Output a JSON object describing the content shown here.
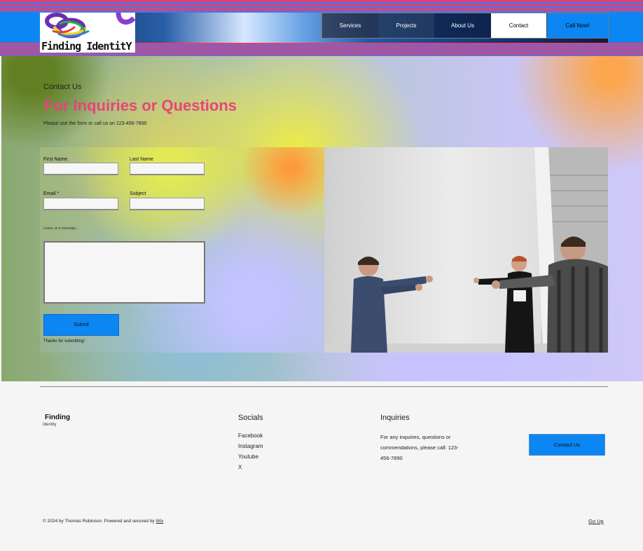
{
  "brand": {
    "logo_text": "Finding IdentitY"
  },
  "nav": {
    "items": [
      {
        "label": "Services"
      },
      {
        "label": "Projects"
      },
      {
        "label": "About Us"
      },
      {
        "label": "Contact"
      }
    ],
    "cta_label": "Call Now!"
  },
  "hero": {
    "eyebrow": "Contact Us",
    "headline": "For Inquiries or Questions",
    "lede": "Please use the form or call us on 123-456-7890"
  },
  "form": {
    "first_name_label": "First Name",
    "last_name_label": "Last Name",
    "email_label": "Email *",
    "subject_label": "Subject",
    "message_label": "Leave us a message...",
    "submit_label": "Submit",
    "thanks_text": "Thanks for submitting!"
  },
  "footer": {
    "brand_title": "Finding",
    "brand_subtitle": "Identity",
    "socials_heading": "Socials",
    "socials": [
      "Facebook",
      "Instagram",
      "Youtube",
      "X"
    ],
    "inquiries_heading": "Inquiries",
    "inquiries_text": "For any inquiries, questions or commendations, please call: 123-456-7890",
    "contact_button": "Contact Us",
    "copyright_prefix": "© 2024 by Thomas Robinson. Powered and secured by ",
    "copyright_link": "Wix",
    "go_up": "Go Up"
  },
  "colors": {
    "accent_blue": "#0b86f2",
    "headline_pink": "#e8447a",
    "stripe_pink": "#e23f76",
    "stripe_blue": "#5c6fd4"
  }
}
